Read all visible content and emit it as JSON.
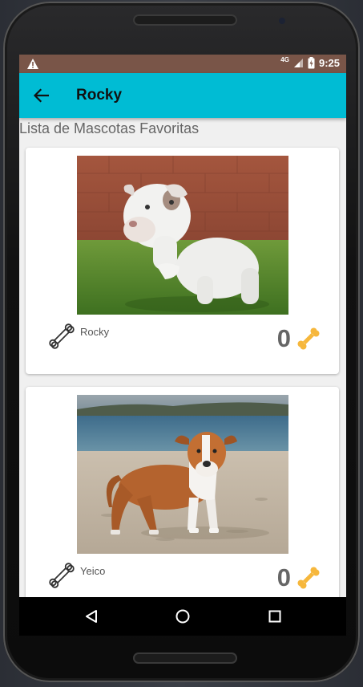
{
  "status_bar": {
    "network": "4G",
    "time": "9:25",
    "icons": [
      "warning-icon",
      "signal-icon",
      "battery-charging-icon"
    ]
  },
  "app_bar": {
    "title": "Rocky",
    "back_icon": "arrow-back-icon"
  },
  "list": {
    "header": "Lista de Mascotas Favoritas",
    "pets": [
      {
        "name": "Rocky",
        "rating": "0",
        "photo": "white pitbull puppy on grass",
        "name_icon": "bone-outline-icon",
        "rating_icon": "bone-filled-icon"
      },
      {
        "name": "Yeico",
        "rating": "0",
        "photo": "brown and white pitbull puppy on beach",
        "name_icon": "bone-outline-icon",
        "rating_icon": "bone-filled-icon"
      }
    ]
  },
  "nav_bar": {
    "buttons": [
      "back-triangle-icon",
      "home-circle-icon",
      "recents-square-icon"
    ]
  },
  "colors": {
    "status_bar": "#795548",
    "app_bar": "#00bcd4",
    "bone_accent": "#f6b73c",
    "background": "#f0f0f0"
  }
}
